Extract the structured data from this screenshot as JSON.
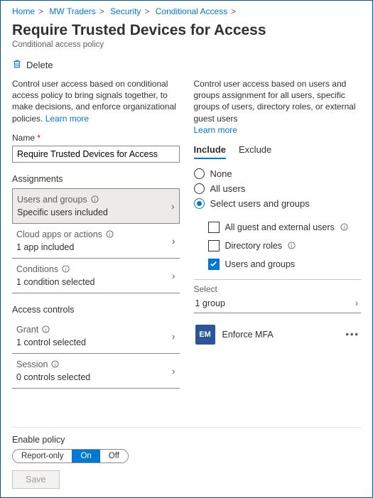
{
  "breadcrumb": [
    {
      "label": "Home"
    },
    {
      "label": "MW Traders"
    },
    {
      "label": "Security"
    },
    {
      "label": "Conditional Access"
    }
  ],
  "title": "Require Trusted Devices for Access",
  "subtitle": "Conditional access policy",
  "delete_label": "Delete",
  "left": {
    "desc_a": "Control user access based on conditional access policy to bring signals together, to make decisions, and enforce organizational policies. ",
    "learn_more": "Learn more",
    "name_label": "Name",
    "name_value": "Require Trusted Devices for Access",
    "assignments_heading": "Assignments",
    "items": [
      {
        "label": "Users and groups",
        "value": "Specific users included",
        "selected": true
      },
      {
        "label": "Cloud apps or actions",
        "value": "1 app included",
        "selected": false
      },
      {
        "label": "Conditions",
        "value": "1 condition selected",
        "selected": false
      }
    ],
    "access_controls_heading": "Access controls",
    "ac_items": [
      {
        "label": "Grant",
        "value": "1 control selected"
      },
      {
        "label": "Session",
        "value": "0 controls selected"
      }
    ]
  },
  "right": {
    "desc": "Control user access based on users and groups assignment for all users, specific groups of users, directory roles, or external guest users",
    "learn_more": "Learn more",
    "tabs": {
      "include": "Include",
      "exclude": "Exclude"
    },
    "radios": {
      "none": "None",
      "all": "All users",
      "select": "Select users and groups"
    },
    "checks": {
      "guests": "All guest and external users",
      "roles": "Directory roles",
      "users_groups": "Users and groups"
    },
    "select_label": "Select",
    "select_value": "1 group",
    "group": {
      "initials": "EM",
      "name": "Enforce MFA"
    }
  },
  "footer": {
    "label": "Enable policy",
    "report": "Report-only",
    "on": "On",
    "off": "Off",
    "save": "Save"
  }
}
